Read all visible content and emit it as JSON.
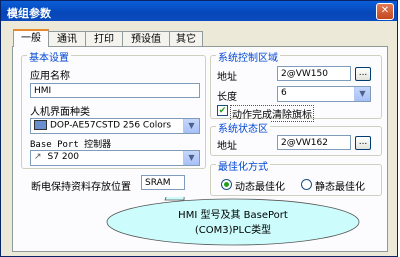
{
  "window": {
    "title": "模组参数",
    "close_label": "✕"
  },
  "tabs": [
    "一般",
    "通讯",
    "打印",
    "预设值",
    "其它"
  ],
  "basic": {
    "legend": "基本设置",
    "app_name_label": "应用名称",
    "app_name_value": "HMI",
    "hmi_type_label": "人机界面种类",
    "hmi_type_value": "DOP-AE57CSTD 256 Colors",
    "base_port_label": "Base Port 控制器",
    "base_port_value": "S7 200",
    "retain_label": "断电保持资料存放位置",
    "retain_value": "SRAM"
  },
  "control": {
    "legend": "系统控制区域",
    "address_label": "地址",
    "address_value": "2@VW150",
    "length_label": "长度",
    "length_value": "6",
    "auto_clear_label": "动作完成清除旗标"
  },
  "status": {
    "legend": "系统状态区",
    "address_label": "地址",
    "address_value": "2@VW162"
  },
  "optimize": {
    "legend": "最佳化方式",
    "dynamic_label": "动态最佳化",
    "static_label": "静态最佳化"
  },
  "browse_label": "...",
  "callout": {
    "line1": "HMI 型号及其 BasePort",
    "line2": "(COM3)PLC类型"
  },
  "colors": {
    "title_bar": "#0a4bbf",
    "legend_text": "#0046d5",
    "accent_tab": "#e68b2c"
  }
}
